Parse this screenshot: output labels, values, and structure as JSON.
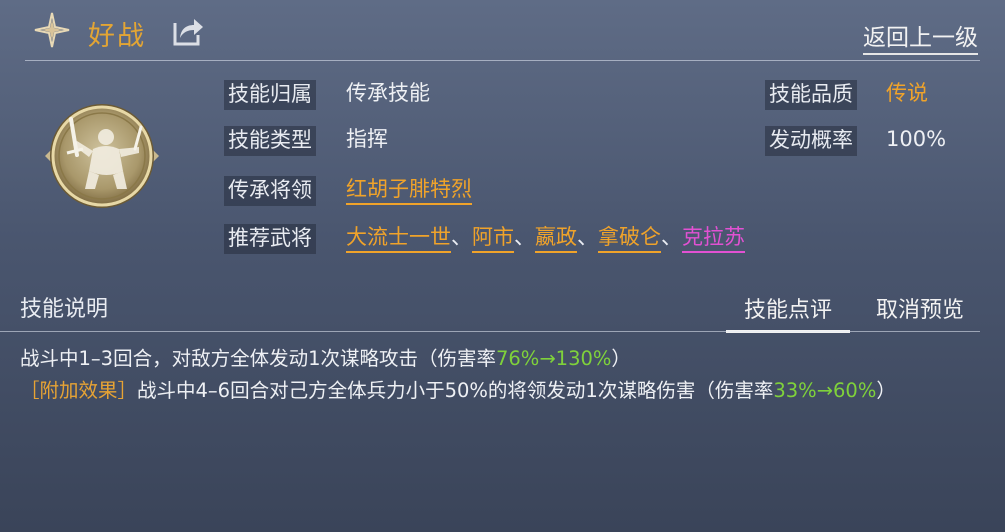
{
  "header": {
    "skill_name": "好战",
    "back_label": "返回上一级"
  },
  "info": {
    "belong": {
      "label": "技能归属",
      "value": "传承技能"
    },
    "type": {
      "label": "技能类型",
      "value": "指挥"
    },
    "inherit_general": {
      "label": "传承将领",
      "value": "红胡子腓特烈"
    },
    "recommend": {
      "label": "推荐武将",
      "generals": [
        "大流士一世",
        "阿市",
        "嬴政",
        "拿破仑",
        "克拉苏"
      ],
      "separator": "、"
    },
    "quality": {
      "label": "技能品质",
      "value": "传说"
    },
    "trigger_rate": {
      "label": "发动概率",
      "value": "100%"
    }
  },
  "section": {
    "title": "技能说明",
    "tab_review": "技能点评",
    "tab_cancel": "取消预览"
  },
  "description": {
    "line1_prefix": "战斗中1–3回合，对敌方全体发动1次谋略攻击（伤害率",
    "line1_value": "76%→130%",
    "line1_suffix": "）",
    "line2_tag": "［附加效果］",
    "line2_prefix": "战斗中4–6回合对己方全体兵力小于50%的将领发动1次谋略伤害（伤害率",
    "line2_value": "33%→60%",
    "line2_suffix": "）"
  },
  "colors": {
    "gold": "#f0a32a",
    "green": "#7fd13b",
    "pink": "#e251d3"
  },
  "icons": {
    "star": "compass-star-icon",
    "share": "share-icon",
    "emblem": "warrior-emblem-icon"
  }
}
